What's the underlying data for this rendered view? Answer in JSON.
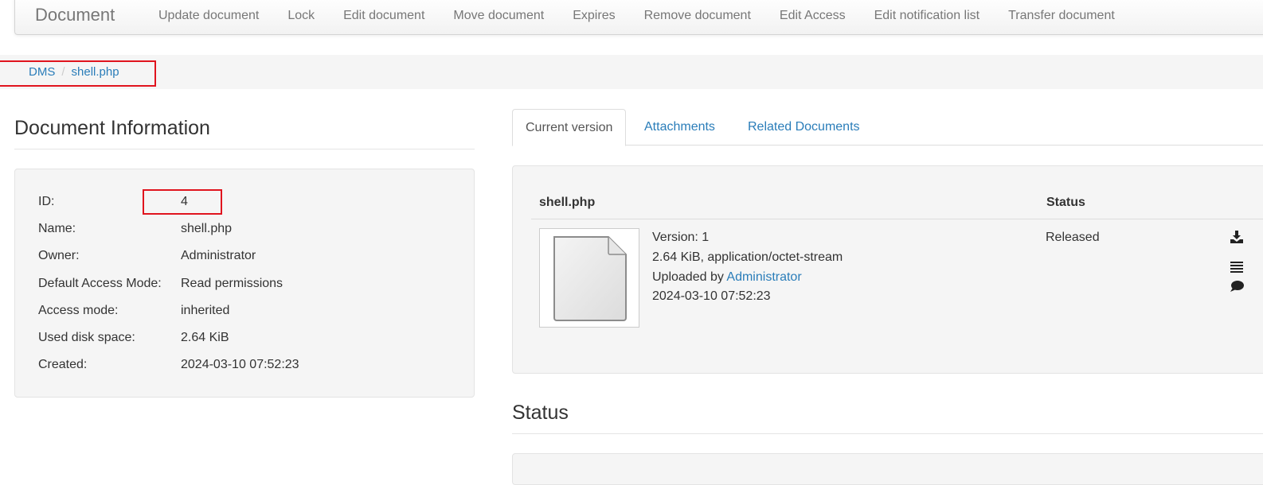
{
  "navbar": {
    "brand": "Document",
    "items": [
      "Update document",
      "Lock",
      "Edit document",
      "Move document",
      "Expires",
      "Remove document",
      "Edit Access",
      "Edit notification list",
      "Transfer document"
    ]
  },
  "breadcrumb": {
    "root": "DMS",
    "separator": "/",
    "current": "shell.php"
  },
  "doc_info": {
    "title": "Document Information",
    "rows": [
      {
        "label": "ID:",
        "value": "4"
      },
      {
        "label": "Name:",
        "value": "shell.php"
      },
      {
        "label": "Owner:",
        "value": "Administrator"
      },
      {
        "label": "Default Access Mode:",
        "value": "Read permissions"
      },
      {
        "label": "Access mode:",
        "value": "inherited"
      },
      {
        "label": "Used disk space:",
        "value": "2.64 KiB"
      },
      {
        "label": "Created:",
        "value": "2024-03-10 07:52:23"
      }
    ]
  },
  "tabs": {
    "current_version": "Current version",
    "attachments": "Attachments",
    "related_documents": "Related Documents"
  },
  "version_table": {
    "col_name": "shell.php",
    "col_status": "Status",
    "version_line": "Version: 1",
    "size_line": "2.64 KiB, application/octet-stream",
    "uploaded_by_prefix": "Uploaded by",
    "uploaded_by_user": "Administrator",
    "uploaded_date": "2024-03-10 07:52:23",
    "status": "Released",
    "action_icons": [
      "download-icon",
      "list-icon",
      "comment-icon"
    ]
  },
  "status_section": {
    "title": "Status"
  },
  "colors": {
    "link": "#2a7db9",
    "highlight": "#e0141e",
    "well_bg": "#f5f5f5"
  }
}
